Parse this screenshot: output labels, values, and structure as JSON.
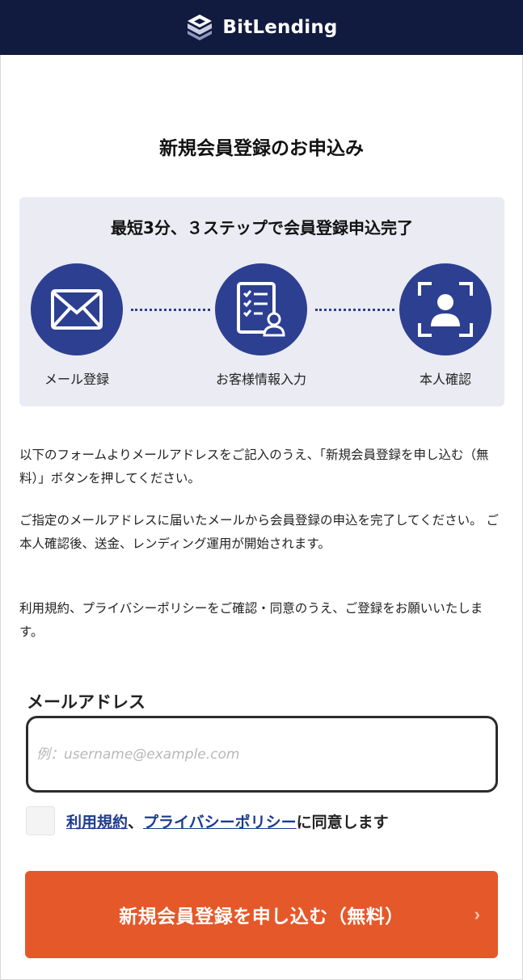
{
  "header": {
    "brand": "BitLending"
  },
  "page_title": "新規会員登録のお申込み",
  "steps": {
    "title": "最短3分、３ステップで会員登録申込完了",
    "items": [
      {
        "label": "メール登録",
        "icon": "envelope-icon"
      },
      {
        "label": "お客様情報入力",
        "icon": "checklist-user-icon"
      },
      {
        "label": "本人確認",
        "icon": "identity-scan-icon"
      }
    ]
  },
  "description": [
    "以下のフォームよりメールアドレスをご記入のうえ、「新規会員登録を申し込む（無料）」ボタンを押してください。",
    "ご指定のメールアドレスに届いたメールから会員登録の申込を完了してください。 ご本人確認後、送金、レンディング運用が開始されます。",
    "利用規約、プライバシーポリシーをご確認・同意のうえ、ご登録をお願いいたします。"
  ],
  "form": {
    "email_label": "メールアドレス",
    "email_placeholder": "例：username@example.com",
    "email_value": "",
    "agree": {
      "terms_link": "利用規約",
      "separator": "、",
      "privacy_link": "プライバシーポリシー",
      "suffix": "に同意します",
      "checked": false
    },
    "submit_label": "新規会員登録を申し込む（無料）",
    "submit_chevron": "›"
  },
  "colors": {
    "header_bg": "#111a3f",
    "accent_blue": "#2d3f91",
    "steps_bg": "#eaebf3",
    "submit_bg": "#e5582a",
    "link": "#1d3b8f"
  }
}
